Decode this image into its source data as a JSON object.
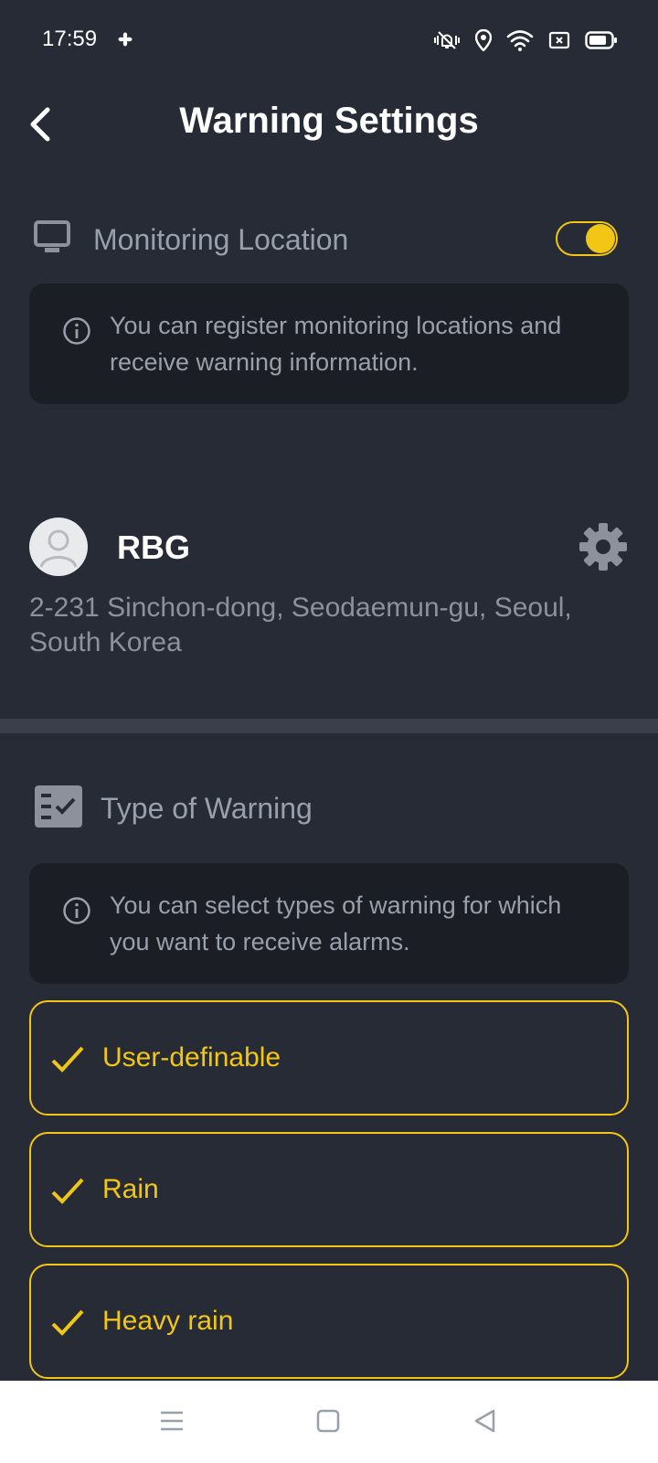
{
  "status_bar": {
    "time": "17:59",
    "icons": [
      "fan-icon",
      "vibrate-off-icon",
      "location-icon",
      "wifi-icon",
      "screen-record-icon",
      "battery-icon"
    ]
  },
  "header": {
    "title": "Warning Settings",
    "back_icon": "chevron-left-icon"
  },
  "monitoring": {
    "icon": "monitor-icon",
    "title": "Monitoring Location",
    "toggle_on": true,
    "info": "You can register monitoring locations and receive warning information."
  },
  "location": {
    "name": "RBG",
    "address": "2-231 Sinchon-dong, Seodaemun-gu, Seoul, South Korea"
  },
  "warnings": {
    "icon": "checklist-icon",
    "title": "Type of Warning",
    "info": "You can select types of warning for which you want to receive alarms.",
    "options": [
      {
        "label": "User-definable",
        "checked": true
      },
      {
        "label": "Rain",
        "checked": true
      },
      {
        "label": "Heavy rain",
        "checked": true
      }
    ]
  },
  "colors": {
    "background": "#262b36",
    "accent": "#f2c615",
    "info_box": "#1b1e25"
  }
}
